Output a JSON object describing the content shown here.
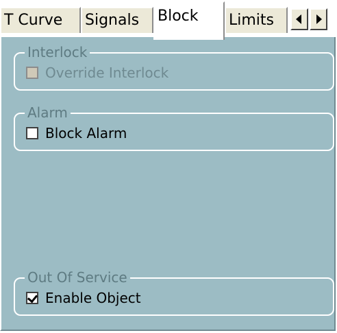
{
  "tabs": [
    {
      "label": "T Curve",
      "active": false
    },
    {
      "label": "Signals",
      "active": false
    },
    {
      "label": "Block",
      "active": true
    },
    {
      "label": "Limits",
      "active": false
    }
  ],
  "scroll_buttons": {
    "left_icon": "arrow-left-icon",
    "right_icon": "arrow-right-icon"
  },
  "groups": {
    "interlock": {
      "title": "Interlock",
      "checkbox_label": "Override Interlock",
      "checked": false,
      "enabled": false
    },
    "alarm": {
      "title": "Alarm",
      "checkbox_label": "Block Alarm",
      "checked": false,
      "enabled": true
    },
    "out_of_service": {
      "title": "Out Of Service",
      "checkbox_label": "Enable Object",
      "checked": true,
      "enabled": true
    }
  },
  "colors": {
    "panel_background": "#9cbcc4",
    "group_title_text": "#5e7b82",
    "tab_background": "#ece9d8"
  }
}
